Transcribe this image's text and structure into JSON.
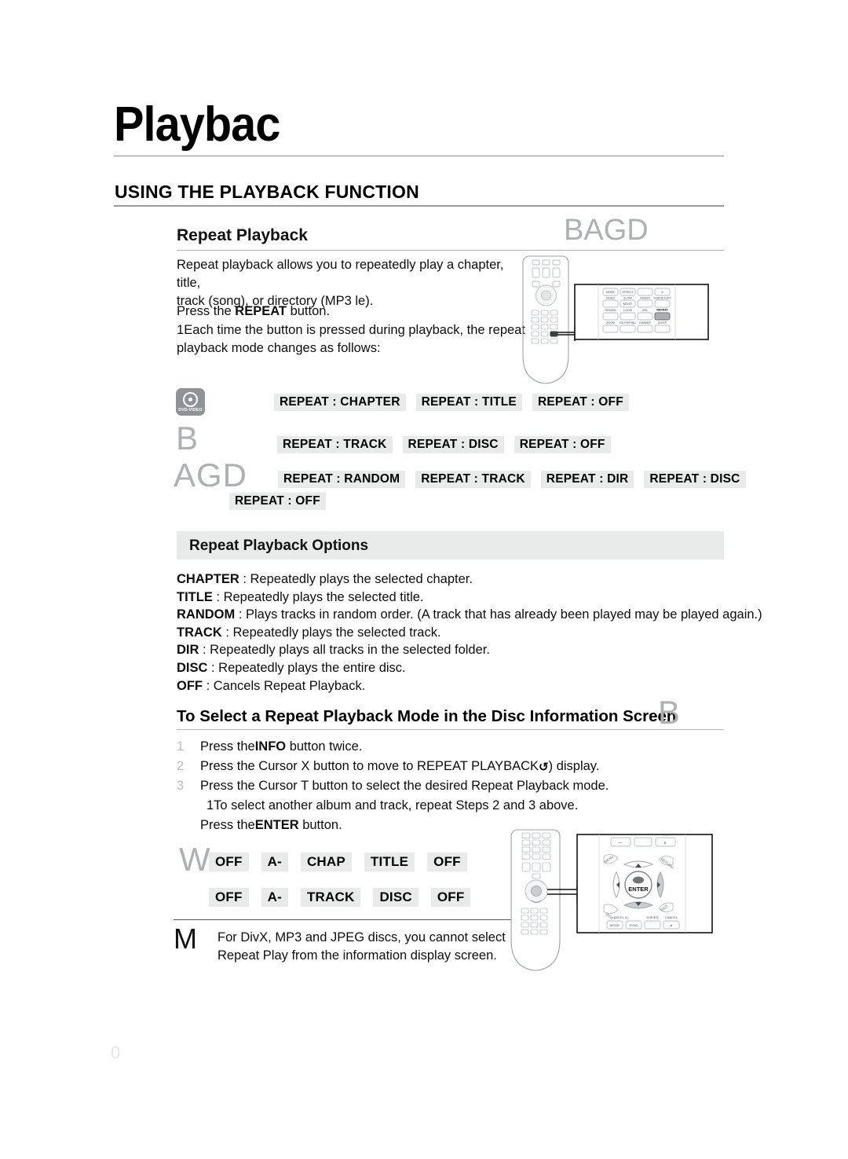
{
  "page": {
    "chapter_title": "Playbac",
    "section_heading": "USING THE PLAYBACK FUNCTION",
    "page_number": "0"
  },
  "repeat_playback": {
    "heading": "Repeat Playback",
    "disc_tags": "BAGD",
    "intro": "Repeat playback allows you to repeatedly play a chapter, title,\ntrack (song), or directory (MP3  le).",
    "press_repeat_pre": "Press the ",
    "press_repeat_strong": "REPEAT",
    "press_repeat_post": " button.",
    "step_marker": "1",
    "step_text": "Each time the button is pressed during playback, the repeat\n  playback mode changes as follows:"
  },
  "mode_rows": {
    "dvd_icon_label": "DVD-VIDEO",
    "marker_b": "B",
    "marker_agd": "AGD",
    "row1": [
      "REPEAT : CHAPTER",
      "REPEAT : TITLE",
      "REPEAT : OFF"
    ],
    "row2": [
      "REPEAT : TRACK",
      "REPEAT : DISC",
      "REPEAT : OFF"
    ],
    "row3": [
      "REPEAT : RANDOM",
      "REPEAT : TRACK",
      "REPEAT : DIR",
      "REPEAT : DISC"
    ],
    "row4": [
      "REPEAT : OFF"
    ]
  },
  "options": {
    "band_title": "Repeat Playback Options",
    "items": [
      {
        "term": "CHAPTER",
        "desc": " : Repeatedly plays the selected chapter."
      },
      {
        "term": "TITLE",
        "desc": " : Repeatedly plays the selected title."
      },
      {
        "term": "RANDOM",
        "desc": " : Plays tracks in random order. (A track that has already been played may be played again.)"
      },
      {
        "term": "TRACK",
        "desc": " : Repeatedly plays the selected track."
      },
      {
        "term": "DIR",
        "desc": " : Repeatedly plays all tracks in the selected folder."
      },
      {
        "term": "DISC",
        "desc": " : Repeatedly plays the entire disc."
      },
      {
        "term": "OFF",
        "desc": " : Cancels Repeat Playback."
      }
    ]
  },
  "disc_info": {
    "heading": "To Select a Repeat Playback Mode in the Disc Information Screen",
    "marker": "B",
    "steps": [
      {
        "num": "1",
        "pre": "Press the",
        "strong": "INFO",
        "post": " button twice."
      },
      {
        "num": "2",
        "pre": "Press the Cursor X button to move to REPEAT PLAYBACK",
        "strong": "",
        "post": ") display.",
        "glyph": "↺"
      },
      {
        "num": "3",
        "pre": "Press the Cursor T button to select the desired Repeat Playback mode.",
        "strong": "",
        "post": ""
      }
    ],
    "sub_step": "1To select another album and track, repeat Steps 2 and 3 above.",
    "enter_pre": "Press the",
    "enter_strong": "ENTER",
    "enter_post": " button."
  },
  "info_rows": {
    "marker_w": "W",
    "row5": [
      "OFF",
      "A-",
      "CHAP",
      "TITLE",
      "OFF"
    ],
    "row6": [
      "OFF",
      "A-",
      "TRACK",
      "DISC",
      "OFF"
    ]
  },
  "note": {
    "marker": "M",
    "text": "For DivX, MP3 and JPEG discs, you cannot select Repeat Play from the information display screen."
  },
  "remote_top": {
    "highlight_button": "REPEAT",
    "buttons": [
      "MODE",
      "EFFECT",
      "SLOW",
      "P.BASS",
      "SOUND EDIT",
      "MO/ST",
      "REMAIN",
      "LOGO",
      "VOL",
      "REPEAT",
      "ZOOM",
      "CD RIPPING",
      "DIMMER",
      "SLEEP"
    ]
  },
  "remote_bottom": {
    "center_label": "ENTER",
    "buttons": [
      "MENU",
      "RETURN",
      "DISC",
      "EXIT",
      "MODE",
      "SYNC",
      "DSP/EQ",
      "CANCEL"
    ]
  },
  "colors": {
    "badge_bg": "#e9eaea",
    "marker_gray": "#adb1b4",
    "rule_gray": "#b5b5b5",
    "text": "#0d0d0d"
  }
}
